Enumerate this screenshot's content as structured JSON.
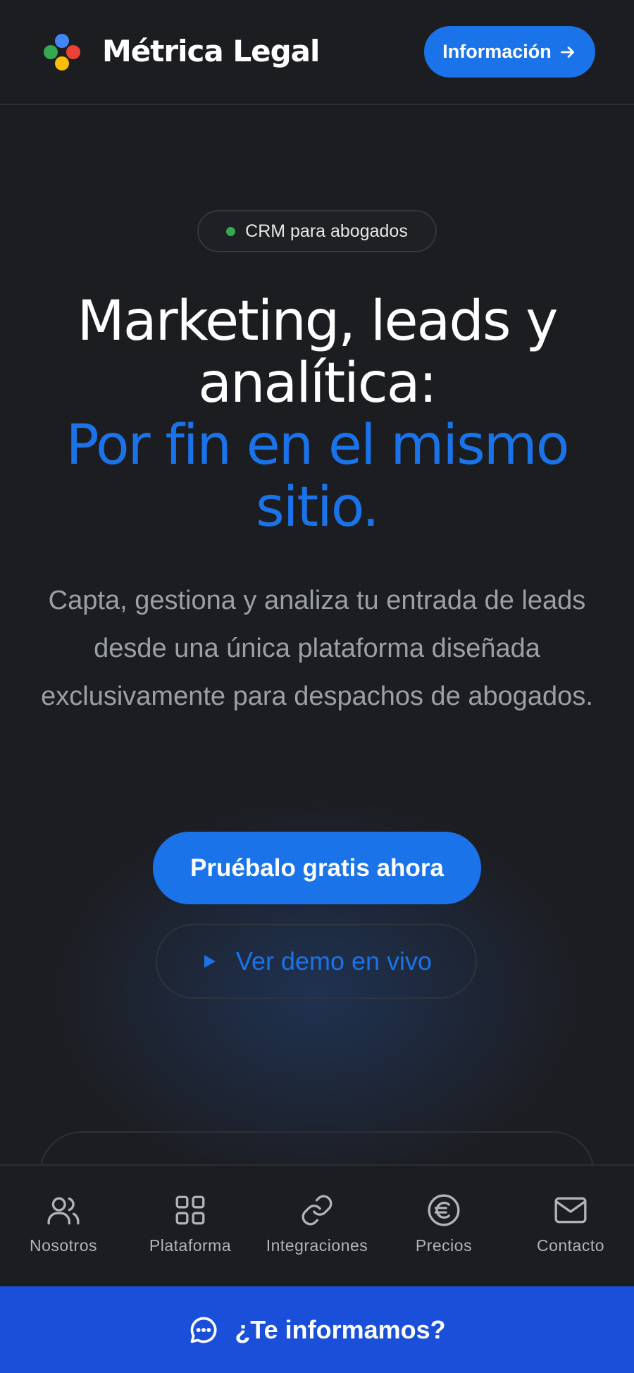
{
  "header": {
    "brand": "Métrica Legal",
    "info_button": "Información"
  },
  "badge": {
    "label": "CRM para abogados"
  },
  "hero": {
    "title_line1": "Marketing, leads y",
    "title_line2": "analítica:",
    "title_line3": "Por fin en el mismo",
    "title_line4": "sitio.",
    "subtitle": "Capta, gestiona y analiza tu entrada de leads desde una única plataforma diseñada exclusivamente para despachos de abogados.",
    "primary_cta": "Pruébalo gratis ahora",
    "secondary_cta": "Ver demo en vivo"
  },
  "bottom_nav": {
    "items": [
      {
        "label": "Nosotros",
        "icon": "users-icon"
      },
      {
        "label": "Plataforma",
        "icon": "grid-icon"
      },
      {
        "label": "Integraciones",
        "icon": "link-icon"
      },
      {
        "label": "Precios",
        "icon": "euro-icon"
      },
      {
        "label": "Contacto",
        "icon": "mail-icon"
      }
    ]
  },
  "chat": {
    "label": "¿Te informamos?"
  },
  "colors": {
    "accent": "#1a73e8",
    "background": "#1c1d21",
    "chat_bar": "#1a4fd9",
    "logo_blue": "#4285f4",
    "logo_green": "#34a853",
    "logo_red": "#ea4335",
    "logo_yellow": "#fbbc04"
  }
}
